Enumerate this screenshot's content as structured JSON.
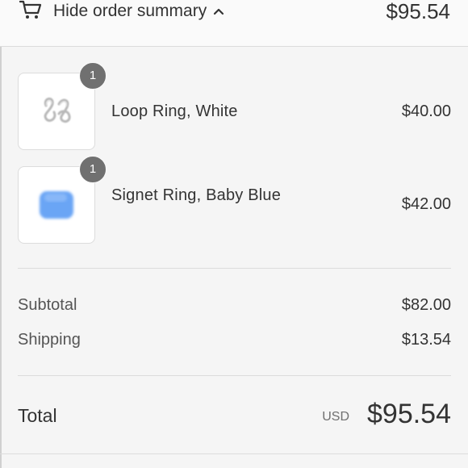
{
  "header": {
    "toggle_label": "Hide order summary",
    "total": "$95.54",
    "cart_icon": "cart-icon",
    "chevron_icon": "chevron-up-icon"
  },
  "items": [
    {
      "quantity": "1",
      "name": "Loop Ring, White",
      "price": "$40.00",
      "thumbnail": "loop-ring-white-image"
    },
    {
      "quantity": "1",
      "name": "Signet Ring, Baby Blue",
      "price": "$42.00",
      "thumbnail": "signet-ring-baby-blue-image"
    }
  ],
  "summary": {
    "subtotal_label": "Subtotal",
    "subtotal_value": "$82.00",
    "shipping_label": "Shipping",
    "shipping_value": "$13.54"
  },
  "total": {
    "label": "Total",
    "currency": "USD",
    "amount": "$95.54"
  },
  "colors": {
    "background": "#f5f5f5",
    "badge": "#707070",
    "text": "#333333",
    "ring_blue": "#6aa5f5"
  }
}
